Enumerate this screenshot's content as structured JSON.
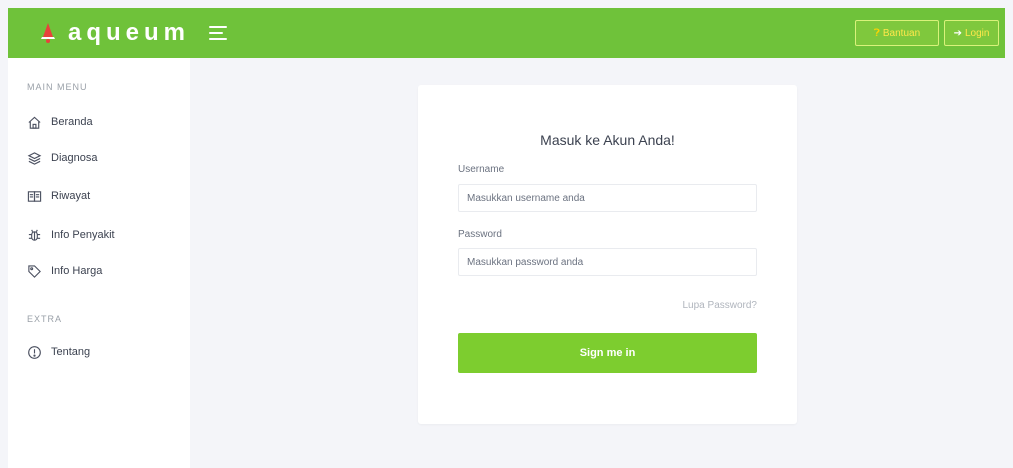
{
  "header": {
    "brand": "aqueum",
    "help_label": "Bantuan",
    "login_label": "Login",
    "logo_icon": "bell-icon",
    "accent_color": "#6fc23a"
  },
  "sidebar": {
    "main_menu_title": "MAIN MENU",
    "items": [
      {
        "label": "Beranda",
        "icon": "home-icon"
      },
      {
        "label": "Diagnosa",
        "icon": "layers-icon"
      },
      {
        "label": "Riwayat",
        "icon": "book-icon"
      },
      {
        "label": "Info Penyakit",
        "icon": "bug-icon"
      },
      {
        "label": "Info Harga",
        "icon": "tag-icon"
      }
    ],
    "extra_title": "EXTRA",
    "extra_items": [
      {
        "label": "Tentang",
        "icon": "info-icon"
      }
    ]
  },
  "login": {
    "title": "Masuk ke Akun Anda!",
    "username_label": "Username",
    "username_placeholder": "Masukkan username anda",
    "password_label": "Password",
    "password_placeholder": "Masukkan password anda",
    "forgot_label": "Lupa Password?",
    "submit_label": "Sign me in"
  }
}
